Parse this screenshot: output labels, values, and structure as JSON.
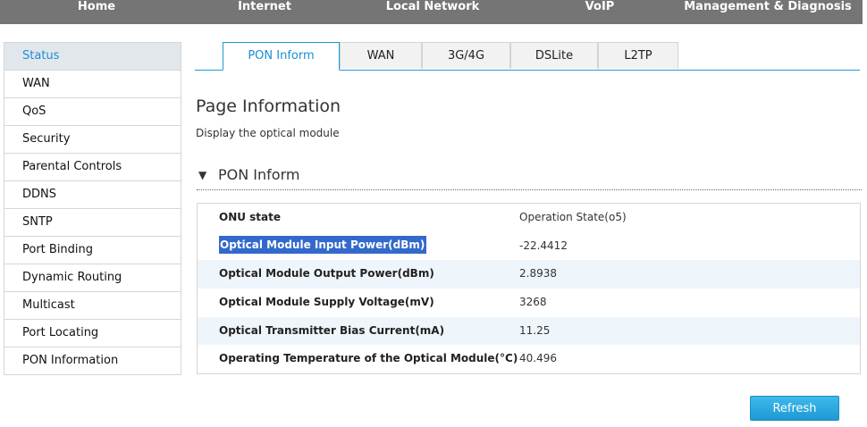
{
  "topnav": [
    {
      "label": "Home"
    },
    {
      "label": "Internet"
    },
    {
      "label": "Local Network"
    },
    {
      "label": "VoIP"
    },
    {
      "label": "Management & Diagnosis"
    }
  ],
  "sidebar": {
    "items": [
      {
        "label": "Status"
      },
      {
        "label": "WAN"
      },
      {
        "label": "QoS"
      },
      {
        "label": "Security"
      },
      {
        "label": "Parental Controls"
      },
      {
        "label": "DDNS"
      },
      {
        "label": "SNTP"
      },
      {
        "label": "Port Binding"
      },
      {
        "label": "Dynamic Routing"
      },
      {
        "label": "Multicast"
      },
      {
        "label": "Port Locating"
      },
      {
        "label": "PON Information"
      }
    ]
  },
  "tabs": [
    {
      "label": "PON Inform"
    },
    {
      "label": "WAN"
    },
    {
      "label": "3G/4G"
    },
    {
      "label": "DSLite"
    },
    {
      "label": "L2TP"
    }
  ],
  "page": {
    "title": "Page Information",
    "description": "Display the optical module"
  },
  "section": {
    "caret": "▼",
    "title": "PON Inform"
  },
  "info": {
    "rows": [
      {
        "label": "ONU state",
        "value": "Operation State(o5)"
      },
      {
        "label": "Optical Module Input Power(dBm)",
        "value": "-22.4412"
      },
      {
        "label": "Optical Module Output Power(dBm)",
        "value": "2.8938"
      },
      {
        "label": "Optical Module Supply Voltage(mV)",
        "value": "3268"
      },
      {
        "label": "Optical Transmitter Bias Current(mA)",
        "value": "11.25"
      },
      {
        "label": "Operating Temperature of the Optical Module(°C)",
        "value": "40.496"
      }
    ]
  },
  "actions": {
    "refresh_label": "Refresh"
  },
  "colors": {
    "nav_bg": "#757575",
    "accent": "#1a9ad6",
    "active_sidebar_bg": "#e2e7ec",
    "selection_bg": "#3369cc",
    "row_alt_bg": "#eef5fb"
  }
}
